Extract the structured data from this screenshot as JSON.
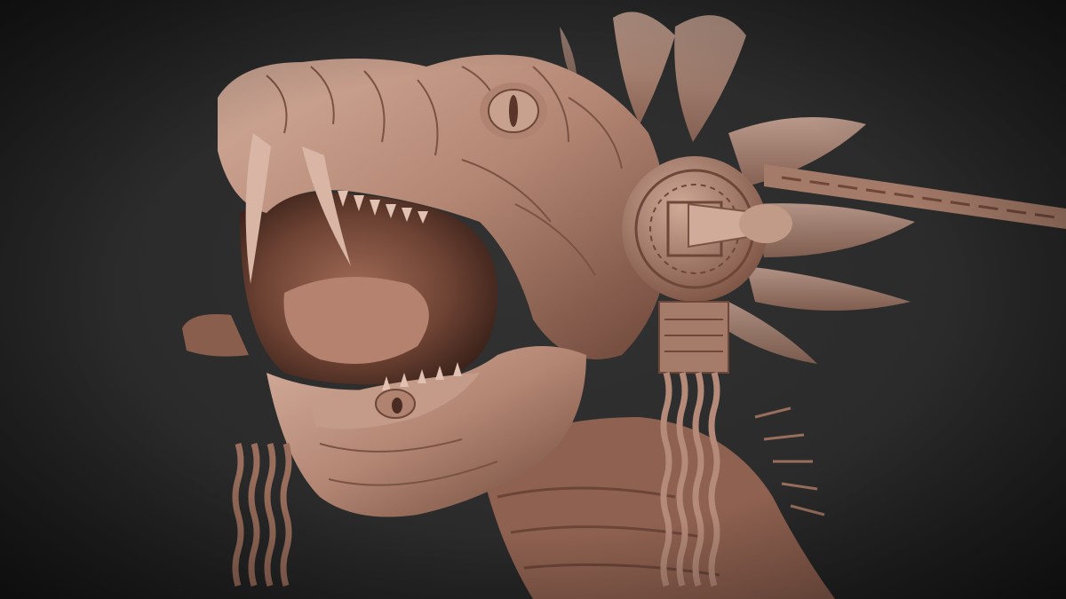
{
  "scene": {
    "subject": "sculpt-render",
    "colors": {
      "background": "#2b2b2b",
      "clay_light": "#c8a190",
      "clay_mid": "#a97d6b",
      "clay_dark": "#6b4638",
      "mouth_inner": "#8a5a48",
      "mouth_shadow": "#4a2c22"
    }
  }
}
